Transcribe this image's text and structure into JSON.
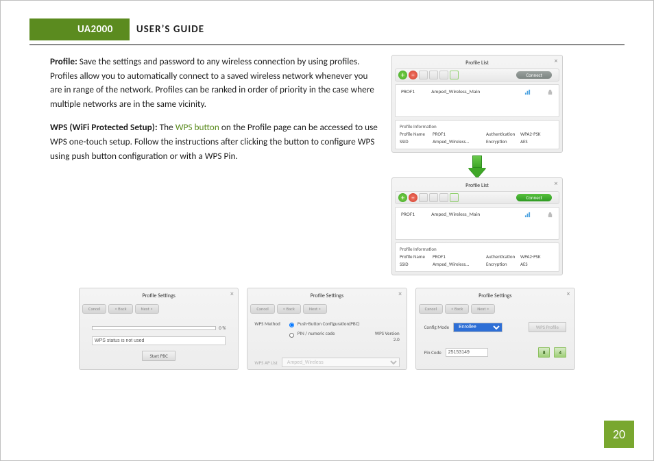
{
  "header": {
    "model": "UA2000",
    "title": "USER’S GUIDE"
  },
  "paragraphs": {
    "profile_label": "Profile:",
    "profile_text": " Save the settings and password to any wireless connection by using profiles. Profiles allow you to automatically connect to a saved wireless network whenever you are in range of the network. Profiles can be ranked in order of priority in the case where multiple networks are in the same vicinity.",
    "wps_label": "WPS (WiFi Protected Setup):",
    "wps_text_before": " The ",
    "wps_link": "WPS button",
    "wps_text_after": " on the Profile page can be accessed to use WPS one-touch setup. Follow the instructions after clicking the button to configure WPS using push button configuration or with a WPS Pin."
  },
  "profile_panel": {
    "title": "Profile List",
    "connect_btn": "Connect",
    "row": {
      "name": "PROF1",
      "ssid": "Amped_Wireless_Main"
    },
    "info": {
      "heading": "Profile Information",
      "name_lbl": "Profile Name",
      "name_val": "PROF1",
      "ssid_lbl": "SSID",
      "ssid_val": "Amped_Wireless…",
      "auth_lbl": "Authentication",
      "auth_val": "WPA2-PSK",
      "enc_lbl": "Encryption",
      "enc_val": "AES"
    }
  },
  "wps_panel1": {
    "title": "Profile Settings",
    "nav": {
      "cancel": "Cancel",
      "back": "<   Back",
      "next": "Next   >"
    },
    "progress": "0 %",
    "status_text": "WPS status is not used",
    "start_btn": "Start PBC"
  },
  "wps_panel2": {
    "title": "Profile Settings",
    "nav": {
      "cancel": "Cancel",
      "back": "<   Back",
      "next": "Next   >"
    },
    "method_lbl": "WPS Method",
    "opt_pbc": "Push-Button Configuration(PBC)",
    "opt_pin": "PIN / numeric code",
    "ver_lbl": "WPS Version",
    "ver_val": "2.0",
    "aplist_lbl": "WPS AP List",
    "aplist_val": "Amped_Wireless"
  },
  "wps_panel3": {
    "title": "Profile Settings",
    "nav": {
      "cancel": "Cancel",
      "back": "<   Back",
      "next": "Next   >"
    },
    "config_lbl": "Config Mode",
    "config_val": "Enrollee",
    "wpsprofile_btn": "WPS Profile",
    "pin_lbl": "Pin Code",
    "pin_val": "25153149",
    "eight": "8",
    "four": "4"
  },
  "page_number": "20"
}
